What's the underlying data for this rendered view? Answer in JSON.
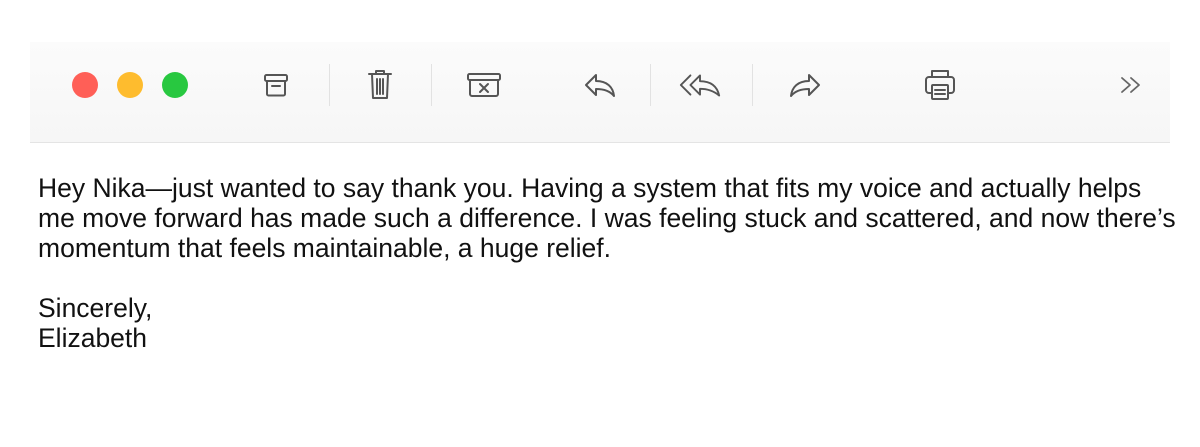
{
  "window": {
    "traffic_lights": [
      "close",
      "minimize",
      "zoom"
    ],
    "colors": {
      "close": "#ff5f57",
      "minimize": "#febc2e",
      "zoom": "#28c840"
    }
  },
  "toolbar": {
    "buttons": [
      {
        "name": "archive",
        "icon": "archive-icon"
      },
      {
        "name": "delete",
        "icon": "trash-icon"
      },
      {
        "name": "junk",
        "icon": "junk-icon"
      },
      {
        "name": "reply",
        "icon": "reply-icon"
      },
      {
        "name": "reply-all",
        "icon": "reply-all-icon"
      },
      {
        "name": "forward",
        "icon": "forward-icon"
      },
      {
        "name": "print",
        "icon": "printer-icon"
      },
      {
        "name": "more",
        "icon": "chevron-double-right-icon"
      }
    ]
  },
  "message": {
    "paragraph": "Hey Nika—just wanted to say thank you. Having a system that fits my voice and actually helps me move forward has made such a difference. I was feeling stuck and scattered, and now there’s momentum that feels maintainable, a huge relief.",
    "closing": "Sincerely,",
    "signature": "Elizabeth"
  }
}
